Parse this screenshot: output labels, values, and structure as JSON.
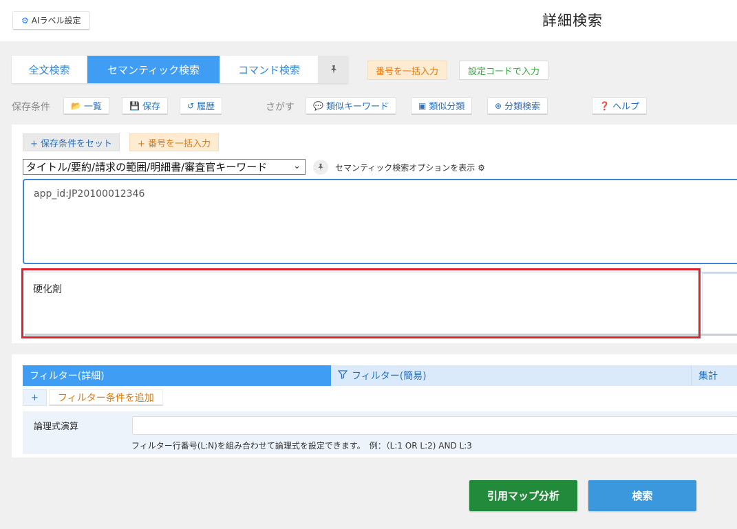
{
  "header": {
    "ai_label_btn": "AIラベル設定",
    "title": "詳細検索"
  },
  "tabs": [
    {
      "label": "全文検索",
      "active": false
    },
    {
      "label": "セマンティック検索",
      "active": true
    },
    {
      "label": "コマンド検索",
      "active": false
    }
  ],
  "top_actions": {
    "bulk_number": "番号を一括入力",
    "setting_code": "設定コードで入力"
  },
  "saved": {
    "label": "保存条件",
    "list": "一覧",
    "save": "保存",
    "history": "履歴"
  },
  "find": {
    "label": "さがす",
    "similar_keyword": "類似キーワード",
    "similar_class": "類似分類",
    "class_search": "分類検索",
    "help": "ヘルプ"
  },
  "semantic": {
    "set_conditions": "+ 保存条件をセット",
    "bulk_number": "+ 番号を一括入力",
    "field_select": "タイトル/要約/請求の範囲/明細書/審査官キーワード",
    "show_options": "セマンティック検索オプションを表示",
    "query_text": "app_id:JP20100012346",
    "keyword_text": "硬化剤"
  },
  "filter": {
    "tab_detail": "フィルター(詳細)",
    "tab_simple": "フィルター(簡易)",
    "tab_aggregate": "集計",
    "plus": "+",
    "add_condition": "フィルター条件を追加",
    "logic_label": "論理式演算",
    "logic_value": "",
    "logic_hint": "フィルター行番号(L:N)を組み合わせて論理式を設定できます。　例：（L:1 OR L:2) AND L:3"
  },
  "buttons": {
    "citation_map": "引用マップ分析",
    "search": "検索"
  },
  "colors": {
    "accent_blue": "#3f9ef3",
    "orange": "#e07a12",
    "green_button": "#228b3b",
    "highlight_red": "#e01e2c"
  }
}
